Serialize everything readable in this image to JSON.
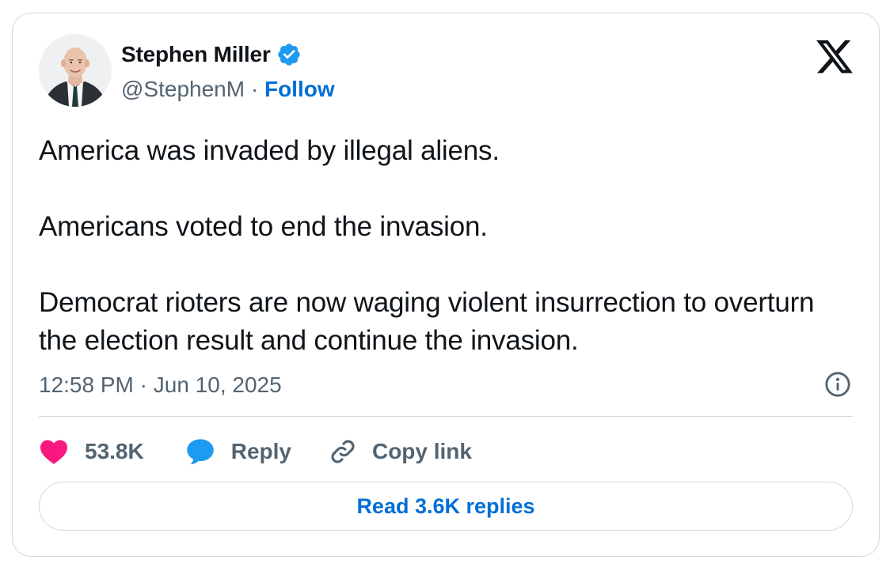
{
  "author": {
    "name": "Stephen Miller",
    "handle": "@StephenM",
    "separator": "·",
    "follow_label": "Follow",
    "verified_icon": "verified-badge-icon",
    "avatar_icon": "avatar"
  },
  "brand": {
    "logo_icon": "x-logo-icon"
  },
  "tweet": {
    "paragraphs": [
      "America was invaded by illegal aliens.",
      "Americans voted to end the invasion.",
      "Democrat rioters are now waging violent insurrection to overturn the election result and continue the invasion."
    ],
    "time": "12:58 PM",
    "date_separator": "·",
    "date": "Jun 10, 2025"
  },
  "actions": {
    "likes": "53.8K",
    "reply_label": "Reply",
    "copy_link_label": "Copy link"
  },
  "replies_button_label": "Read 3.6K replies",
  "colors": {
    "link_blue": "#006fd6",
    "verified_blue": "#1d9bf0",
    "like_pink": "#f91880",
    "reply_blue": "#1d9bf0",
    "secondary_text": "#536471",
    "border": "#cfd9de"
  }
}
